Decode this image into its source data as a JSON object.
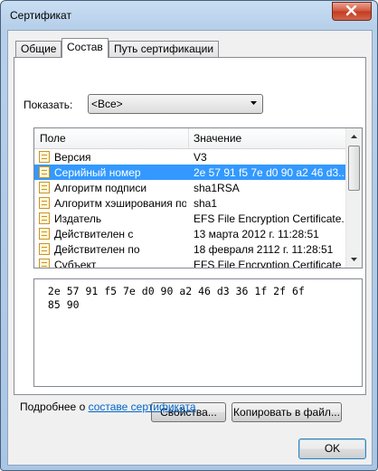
{
  "window": {
    "title": "Сертификат"
  },
  "tabs": [
    {
      "label": "Общие"
    },
    {
      "label": "Состав"
    },
    {
      "label": "Путь сертификации"
    }
  ],
  "show": {
    "label": "Показать:",
    "value": "<Все>"
  },
  "table": {
    "columns": [
      "Поле",
      "Значение"
    ],
    "rows": [
      {
        "name": "Версия",
        "value": "V3",
        "selected": false
      },
      {
        "name": "Серийный номер",
        "value": "2e 57 91 f5 7e d0 90 a2 46 d3...",
        "selected": true
      },
      {
        "name": "Алгоритм подписи",
        "value": "sha1RSA",
        "selected": false
      },
      {
        "name": "Алгоритм хэширования по...",
        "value": "sha1",
        "selected": false
      },
      {
        "name": "Издатель",
        "value": "EFS File Encryption Certificate...",
        "selected": false
      },
      {
        "name": "Действителен с",
        "value": "13 марта 2012 г. 11:28:51",
        "selected": false
      },
      {
        "name": "Действителен по",
        "value": "18 февраля 2112 г. 11:28:51",
        "selected": false
      },
      {
        "name": "Субъект",
        "value": "EFS File Encryption Certificate",
        "selected": false
      }
    ]
  },
  "detail": {
    "text": " 2e 57 91 f5 7e d0 90 a2 46 d3 36 1f 2f 6f\n 85 90"
  },
  "buttons": {
    "properties": "Свойства...",
    "copy": "Копировать в файл...",
    "ok": "OK"
  },
  "learn_more": {
    "prefix": "Подробнее о ",
    "link": "составе сертификата"
  }
}
